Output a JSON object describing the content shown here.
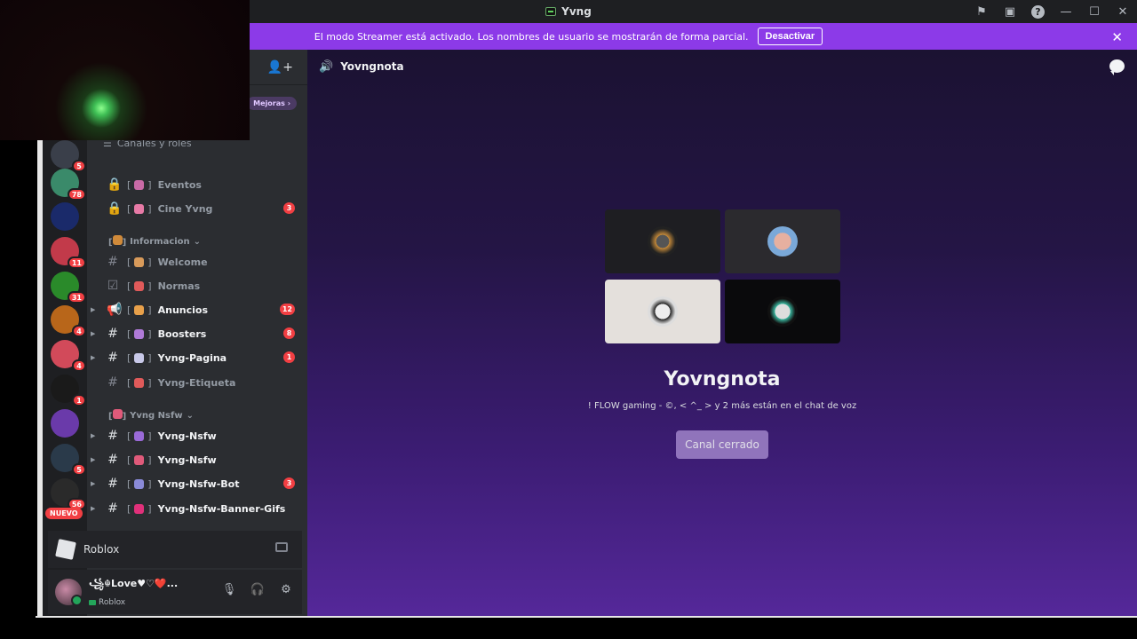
{
  "window": {
    "title": "Yvng"
  },
  "banner": {
    "message": "El modo Streamer está activado. Los nombres de usuario se mostrarán de forma parcial.",
    "button": "Desactivar"
  },
  "sidebar": {
    "boost_label": "Mejoras",
    "roles_label": "Canales y roles",
    "categories": [
      {
        "label": "Informacion"
      },
      {
        "label": "Yvng Nsfw"
      }
    ],
    "channels": [
      {
        "name": "Eventos",
        "badge": ""
      },
      {
        "name": "Cine Yvng",
        "badge": "3"
      },
      {
        "name": "Welcome",
        "badge": ""
      },
      {
        "name": "Normas",
        "badge": ""
      },
      {
        "name": "Anuncios",
        "badge": "12"
      },
      {
        "name": "Boosters",
        "badge": "8"
      },
      {
        "name": "Yvng-Pagina",
        "badge": "1"
      },
      {
        "name": "Yvng-Etiqueta",
        "badge": ""
      },
      {
        "name": "Yvng-Nsfw",
        "badge": ""
      },
      {
        "name": "Yvng-Nsfw",
        "badge": ""
      },
      {
        "name": "Yvng-Nsfw-Bot",
        "badge": "3"
      },
      {
        "name": "Yvng-Nsfw-Banner-Gifs",
        "badge": ""
      }
    ],
    "server_badges": [
      "5",
      "78",
      "",
      "11",
      "31",
      "4",
      "4",
      "1",
      "",
      "5",
      "56"
    ],
    "new_label": "NUEVO"
  },
  "activity": {
    "game": "Roblox"
  },
  "user": {
    "name": "꧁☬Love♥︎♡❤️...",
    "status": "Roblox"
  },
  "voice": {
    "channel_title": "Yovngnota",
    "name": "Yovngnota",
    "members_text": "! FLOW gaming - ©, < ^_ > y 2 más están en el chat de voz",
    "button": "Canal cerrado"
  },
  "colors": {
    "banner": "#8c3ae8",
    "badge": "#f23f43",
    "online": "#23a55a"
  }
}
